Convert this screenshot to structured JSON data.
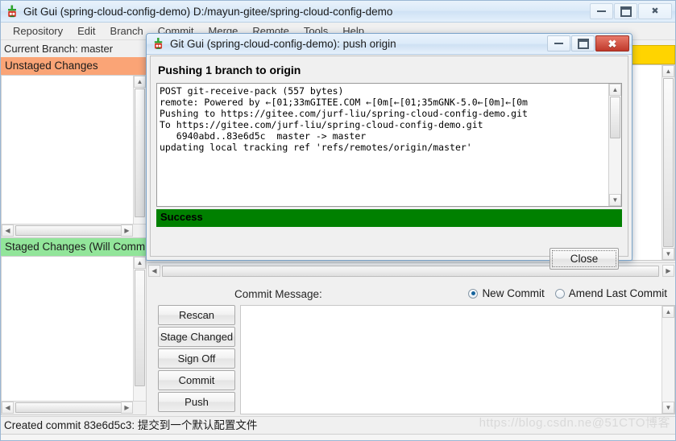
{
  "main_window": {
    "title": "Git Gui (spring-cloud-config-demo) D:/mayun-gitee/spring-cloud-config-demo",
    "icon": "git-gui-icon",
    "controls": {
      "minimize": "minimize-icon",
      "maximize": "maximize-icon",
      "close": "close-icon"
    }
  },
  "menubar": {
    "items": [
      {
        "label": "Repository"
      },
      {
        "label": "Edit"
      },
      {
        "label": "Branch"
      },
      {
        "label": "Commit"
      },
      {
        "label": "Merge"
      },
      {
        "label": "Remote"
      },
      {
        "label": "Tools"
      },
      {
        "label": "Help"
      }
    ]
  },
  "sidebar": {
    "branch_line": "Current Branch: master",
    "unstaged_header": "Unstaged Changes",
    "staged_header": "Staged Changes (Will Commit)",
    "unstaged_color": "#faa476",
    "staged_color": "#92e59a",
    "unstaged_files": [],
    "staged_files": []
  },
  "commit_area": {
    "label": "Commit Message:",
    "new_commit_label": "New Commit",
    "amend_label": "Amend Last Commit",
    "selected": "New Commit",
    "message_value": "",
    "buttons": [
      {
        "label": "Rescan"
      },
      {
        "label": "Stage Changed"
      },
      {
        "label": "Sign Off"
      },
      {
        "label": "Commit"
      },
      {
        "label": "Push"
      }
    ]
  },
  "statusbar": {
    "text": "Created commit 83e6d5c3: 提交到一个默认配置文件",
    "watermark": "https://blog.csdn.ne@51CTO博客"
  },
  "dialog": {
    "title": "Git Gui (spring-cloud-config-demo): push origin",
    "icon": "git-gui-icon",
    "heading": "Pushing 1 branch to origin",
    "console_lines": [
      "POST git-receive-pack (557 bytes)",
      "remote: Powered by ←[01;33mGITEE.COM ←[0m[←[01;35mGNK-5.0←[0m]←[0m",
      "Pushing to https://gitee.com/jurf-liu/spring-cloud-config-demo.git",
      "To https://gitee.com/jurf-liu/spring-cloud-config-demo.git",
      "   6940abd..83e6d5c  master -> master",
      "updating local tracking ref 'refs/remotes/origin/master'"
    ],
    "status_label": "Success",
    "status_color": "#008000",
    "close_button": "Close",
    "controls": {
      "minimize": "minimize-icon",
      "maximize": "maximize-icon",
      "close": "close-icon"
    }
  }
}
